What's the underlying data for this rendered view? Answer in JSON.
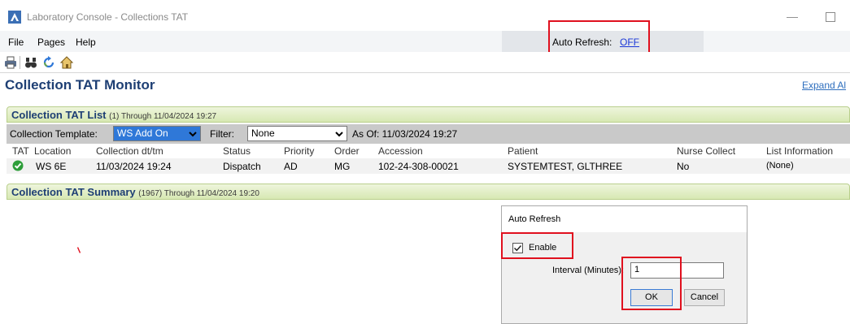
{
  "window": {
    "title": "Laboratory Console - Collections TAT",
    "minimize": "—"
  },
  "menu": {
    "items": [
      "File",
      "Pages",
      "Help"
    ],
    "auto_refresh_label": "Auto Refresh:",
    "auto_refresh_value": "OFF"
  },
  "page": {
    "title": "Collection TAT Monitor",
    "expand_link": "Expand Al"
  },
  "tat_list": {
    "title": "Collection TAT List",
    "subtitle": "(1) Through 11/04/2024 19:27",
    "template_label": "Collection Template:",
    "template_value": "WS Add On",
    "filter_label": "Filter:",
    "filter_value": "None",
    "as_of": "As Of: 11/03/2024 19:27",
    "columns": [
      "TAT",
      "Location",
      "Collection dt/tm",
      "Status",
      "Priority",
      "Order",
      "Accession",
      "Patient",
      "Nurse Collect",
      "List Information"
    ],
    "rows": [
      {
        "location": "WS 6E",
        "collection_dt": "11/03/2024 19:24",
        "status": "Dispatch",
        "priority": "AD",
        "order": "MG",
        "accession": "102-24-308-00021",
        "patient": "SYSTEMTEST, GLTHREE",
        "nurse_collect": "No",
        "list_info": "(None)"
      }
    ]
  },
  "tat_summary": {
    "title": "Collection TAT Summary",
    "subtitle": "(1967) Through 11/04/2024 19:20"
  },
  "dialog": {
    "title": "Auto Refresh",
    "enable_label": "Enable",
    "enable_checked": true,
    "interval_label": "Interval (Minutes):",
    "interval_value": "1",
    "ok_label": "OK",
    "cancel_label": "Cancel"
  },
  "colors": {
    "accent_red": "#e0101e",
    "header_blue": "#1e3f74",
    "link_blue": "#1a37d8",
    "section_green": "#d7e8b3",
    "select_blue": "#2f78d8"
  }
}
